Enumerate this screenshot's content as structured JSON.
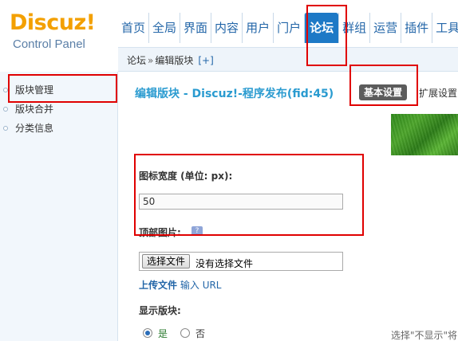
{
  "brand": {
    "name": "Discuz!",
    "subtitle": "Control Panel"
  },
  "nav": {
    "items": [
      {
        "label": "首页"
      },
      {
        "label": "全局"
      },
      {
        "label": "界面"
      },
      {
        "label": "内容"
      },
      {
        "label": "用户"
      },
      {
        "label": "门户"
      },
      {
        "label": "论坛",
        "active": true
      },
      {
        "label": "群组"
      },
      {
        "label": "运营"
      },
      {
        "label": "插件"
      },
      {
        "label": "工具"
      }
    ]
  },
  "breadcrumb": {
    "items": [
      "论坛",
      "编辑版块"
    ],
    "separator": "»",
    "add": "[+]"
  },
  "sidebar": {
    "items": [
      {
        "label": "版块管理",
        "highlighted": true
      },
      {
        "label": "版块合并"
      },
      {
        "label": "分类信息"
      }
    ]
  },
  "main": {
    "title": "编辑版块 - Discuz!-程序发布(fid:45)",
    "tabs": {
      "basic": "基本设置",
      "extended": "扩展设置"
    },
    "icon_width": {
      "label": "图标宽度 (单位: px):",
      "value": "50"
    },
    "banner": {
      "label": "顶部图片:",
      "help": "?"
    },
    "file_input": {
      "button": "选择文件",
      "status": "没有选择文件"
    },
    "upload_links": {
      "upload": "上传文件",
      "input": "输入",
      "url": "URL"
    },
    "show_forum": {
      "label": "显示版块:",
      "options": [
        {
          "label": "是",
          "checked": true
        },
        {
          "label": "否",
          "checked": false
        }
      ],
      "hint": "选择\"不显示\"将"
    }
  },
  "colors": {
    "accent": "#1d79c6",
    "title": "#2a9bd0",
    "highlight": "#e00000",
    "logo": "#f3a001"
  }
}
